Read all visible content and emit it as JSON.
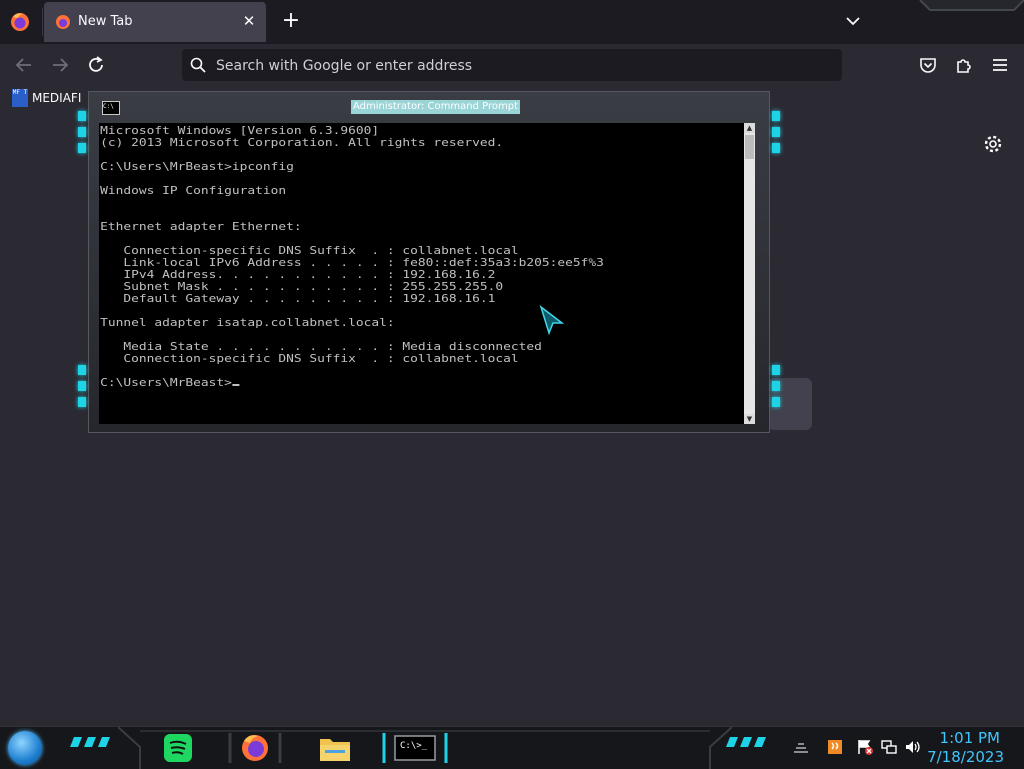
{
  "browser": {
    "tab": {
      "title": "New Tab"
    },
    "url_placeholder": "Search with Google or enter address",
    "bookmark": {
      "label": "MEDIAFIRE",
      "icon_text": "MF T"
    }
  },
  "cmd": {
    "title": "Administrator: Command Prompt",
    "icon_text": "C:\\",
    "lines": [
      "Microsoft Windows [Version 6.3.9600]",
      "(c) 2013 Microsoft Corporation. All rights reserved.",
      "",
      "C:\\Users\\MrBeast>ipconfig",
      "",
      "Windows IP Configuration",
      "",
      "",
      "Ethernet adapter Ethernet:",
      "",
      "   Connection-specific DNS Suffix  . : collabnet.local",
      "   Link-local IPv6 Address . . . . . : fe80::def:35a3:b205:ee5f%3",
      "   IPv4 Address. . . . . . . . . . . : 192.168.16.2",
      "   Subnet Mask . . . . . . . . . . . : 255.255.255.0",
      "   Default Gateway . . . . . . . . . : 192.168.16.1",
      "",
      "Tunnel adapter isatap.collabnet.local:",
      "",
      "   Media State . . . . . . . . . . . : Media disconnected",
      "   Connection-specific DNS Suffix  . : collabnet.local",
      "",
      "C:\\Users\\MrBeast>"
    ]
  },
  "taskbar": {
    "clock_time": "1:01 PM",
    "clock_date": "7/18/2023",
    "cmd_thumb_text": "C:\\>_",
    "apps": [
      "spotify-icon",
      "firefox-icon",
      "file-explorer-icon",
      "command-prompt-icon"
    ]
  },
  "colors": {
    "browser_bg": "#2b2a33",
    "tabbar_bg": "#1c1b22",
    "accent_cyan": "#1fd3e6",
    "clock_blue": "#3fc6ff",
    "console_text": "#c0c0c0"
  }
}
